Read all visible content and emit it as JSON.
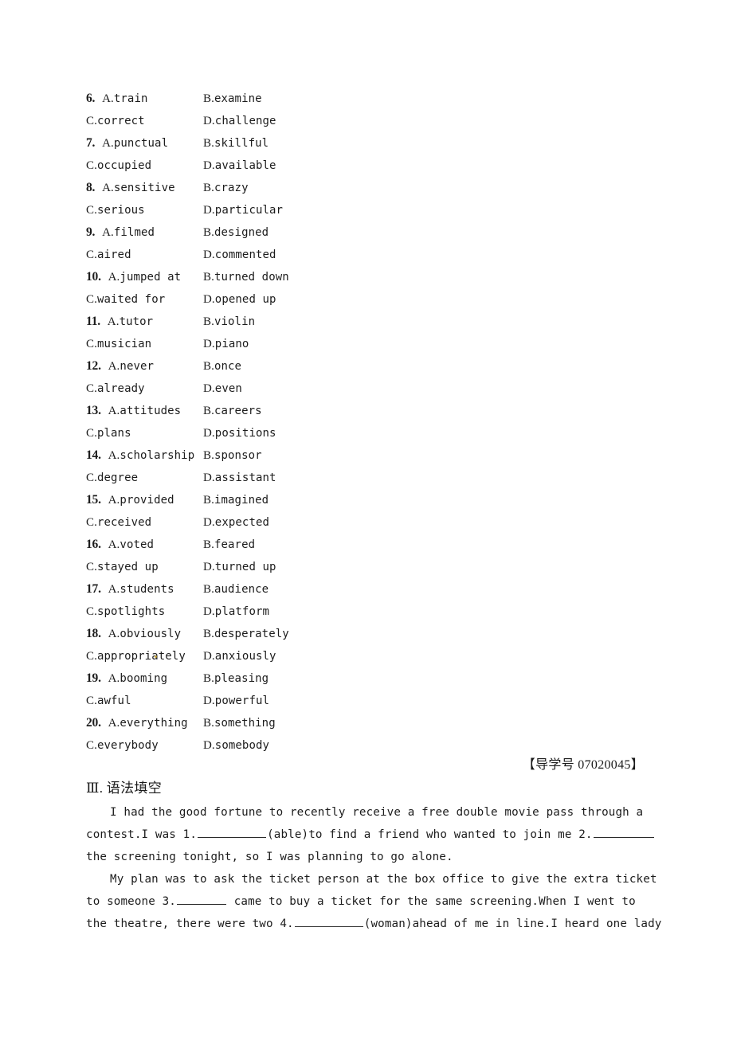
{
  "document": {
    "type": "exam-worksheet-page",
    "reference_code": "【导学号 07020045】",
    "section_heading": "Ⅲ. 语法填空"
  },
  "cloze": {
    "items": [
      {
        "number": "6.",
        "A": "train",
        "B": "examine",
        "C": "correct",
        "D": "challenge"
      },
      {
        "number": "7.",
        "A": "punctual",
        "B": "skillful",
        "C": "occupied",
        "D": "available"
      },
      {
        "number": "8.",
        "A": "sensitive",
        "B": "crazy",
        "C": "serious",
        "D": "particular"
      },
      {
        "number": "9.",
        "A": "filmed",
        "B": "designed",
        "C": "aired",
        "D": "commented"
      },
      {
        "number": "10.",
        "A": "jumped at",
        "B": "turned down",
        "C": "waited for",
        "D": "opened up"
      },
      {
        "number": "11.",
        "A": "tutor",
        "B": "violin",
        "C": "musician",
        "D": "piano"
      },
      {
        "number": "12.",
        "A": "never",
        "B": "once",
        "C": "already",
        "D": "even"
      },
      {
        "number": "13.",
        "A": "attitudes",
        "B": "careers",
        "C": "plans",
        "D": "positions"
      },
      {
        "number": "14.",
        "A": "scholarship",
        "B": "sponsor",
        "C": "degree",
        "D": "assistant"
      },
      {
        "number": "15.",
        "A": "provided",
        "B": "imagined",
        "C": "received",
        "D": "expected"
      },
      {
        "number": "16.",
        "A": "voted",
        "B": "feared",
        "C": "stayed up",
        "D": "turned up"
      },
      {
        "number": "17.",
        "A": "students",
        "B": "audience",
        "C": "spotlights",
        "D": "platform"
      },
      {
        "number": "18.",
        "A": "obviously",
        "B": "desperately",
        "C": "appropriately",
        "D": "anxiously"
      },
      {
        "number": "19.",
        "A": "booming",
        "B": "pleasing",
        "C": "awful",
        "D": "powerful"
      },
      {
        "number": "20.",
        "A": "everything",
        "B": "something",
        "C": "everybody",
        "D": "somebody"
      }
    ],
    "label_a": "A.",
    "label_b": "B.",
    "label_c": "C.",
    "label_d": "D."
  },
  "passage": {
    "lines": [
      {
        "indent": true,
        "segments": [
          {
            "kind": "text",
            "text": "I had the good fortune to recently receive a free double movie pass through a"
          }
        ]
      },
      {
        "indent": false,
        "segments": [
          {
            "kind": "text",
            "text": "contest.I was 1."
          },
          {
            "kind": "blank",
            "size": "lg"
          },
          {
            "kind": "text",
            "text": "(able)to find a friend who wanted to join me 2."
          },
          {
            "kind": "blank",
            "size": "md"
          }
        ]
      },
      {
        "indent": false,
        "segments": [
          {
            "kind": "text",
            "text": "the screening tonight, so I was planning to go alone."
          }
        ]
      },
      {
        "indent": true,
        "segments": [
          {
            "kind": "text",
            "text": "My plan was to ask the ticket person at the box office to give the extra ticket"
          }
        ]
      },
      {
        "indent": false,
        "segments": [
          {
            "kind": "text",
            "text": "to someone 3."
          },
          {
            "kind": "blank",
            "size": "sm"
          },
          {
            "kind": "text",
            "text": " came to buy a ticket for the same screening.When I went to"
          }
        ]
      },
      {
        "indent": false,
        "segments": [
          {
            "kind": "text",
            "text": "the theatre, there were two 4."
          },
          {
            "kind": "blank",
            "size": "lg"
          },
          {
            "kind": "text",
            "text": "(woman)ahead of me in line.I heard one lady"
          }
        ]
      }
    ]
  }
}
